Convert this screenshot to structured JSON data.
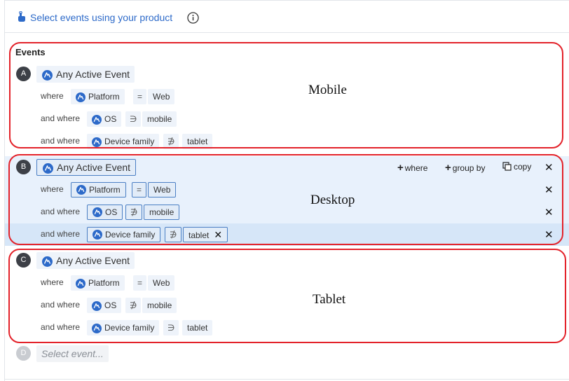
{
  "header": {
    "title": "Select events using your product",
    "tap_icon": "tap-hand-icon",
    "info_icon": "info-icon"
  },
  "events_label": "Events",
  "groups": [
    {
      "letter": "A",
      "event": "Any Active Event",
      "filters": [
        {
          "connector": "where",
          "property": "Platform",
          "operator": "=",
          "value": "Web"
        },
        {
          "connector": "and where",
          "property": "OS",
          "operator": "∋",
          "value": "mobile"
        },
        {
          "connector": "and where",
          "property": "Device family",
          "operator": "∌",
          "value": "tablet"
        }
      ],
      "annotation": "Mobile"
    },
    {
      "letter": "B",
      "event": "Any Active Event",
      "filters": [
        {
          "connector": "where",
          "property": "Platform",
          "operator": "=",
          "value": "Web"
        },
        {
          "connector": "and where",
          "property": "OS",
          "operator": "∌",
          "value": "mobile"
        },
        {
          "connector": "and where",
          "property": "Device family",
          "operator": "∌",
          "value": "tablet"
        }
      ],
      "actions": {
        "where": "where",
        "group_by": "group by",
        "copy": "copy"
      },
      "annotation": "Desktop"
    },
    {
      "letter": "C",
      "event": "Any Active Event",
      "filters": [
        {
          "connector": "where",
          "property": "Platform",
          "operator": "=",
          "value": "Web"
        },
        {
          "connector": "and where",
          "property": "OS",
          "operator": "∌",
          "value": "mobile"
        },
        {
          "connector": "and where",
          "property": "Device family",
          "operator": "∋",
          "value": "tablet"
        }
      ],
      "annotation": "Tablet"
    }
  ],
  "next_group": {
    "letter": "D",
    "placeholder": "Select event..."
  },
  "colors": {
    "accent": "#2d6ac9",
    "annotation": "#e3222a",
    "selected_bg": "#e8f1fc"
  },
  "close_glyph": "✕"
}
